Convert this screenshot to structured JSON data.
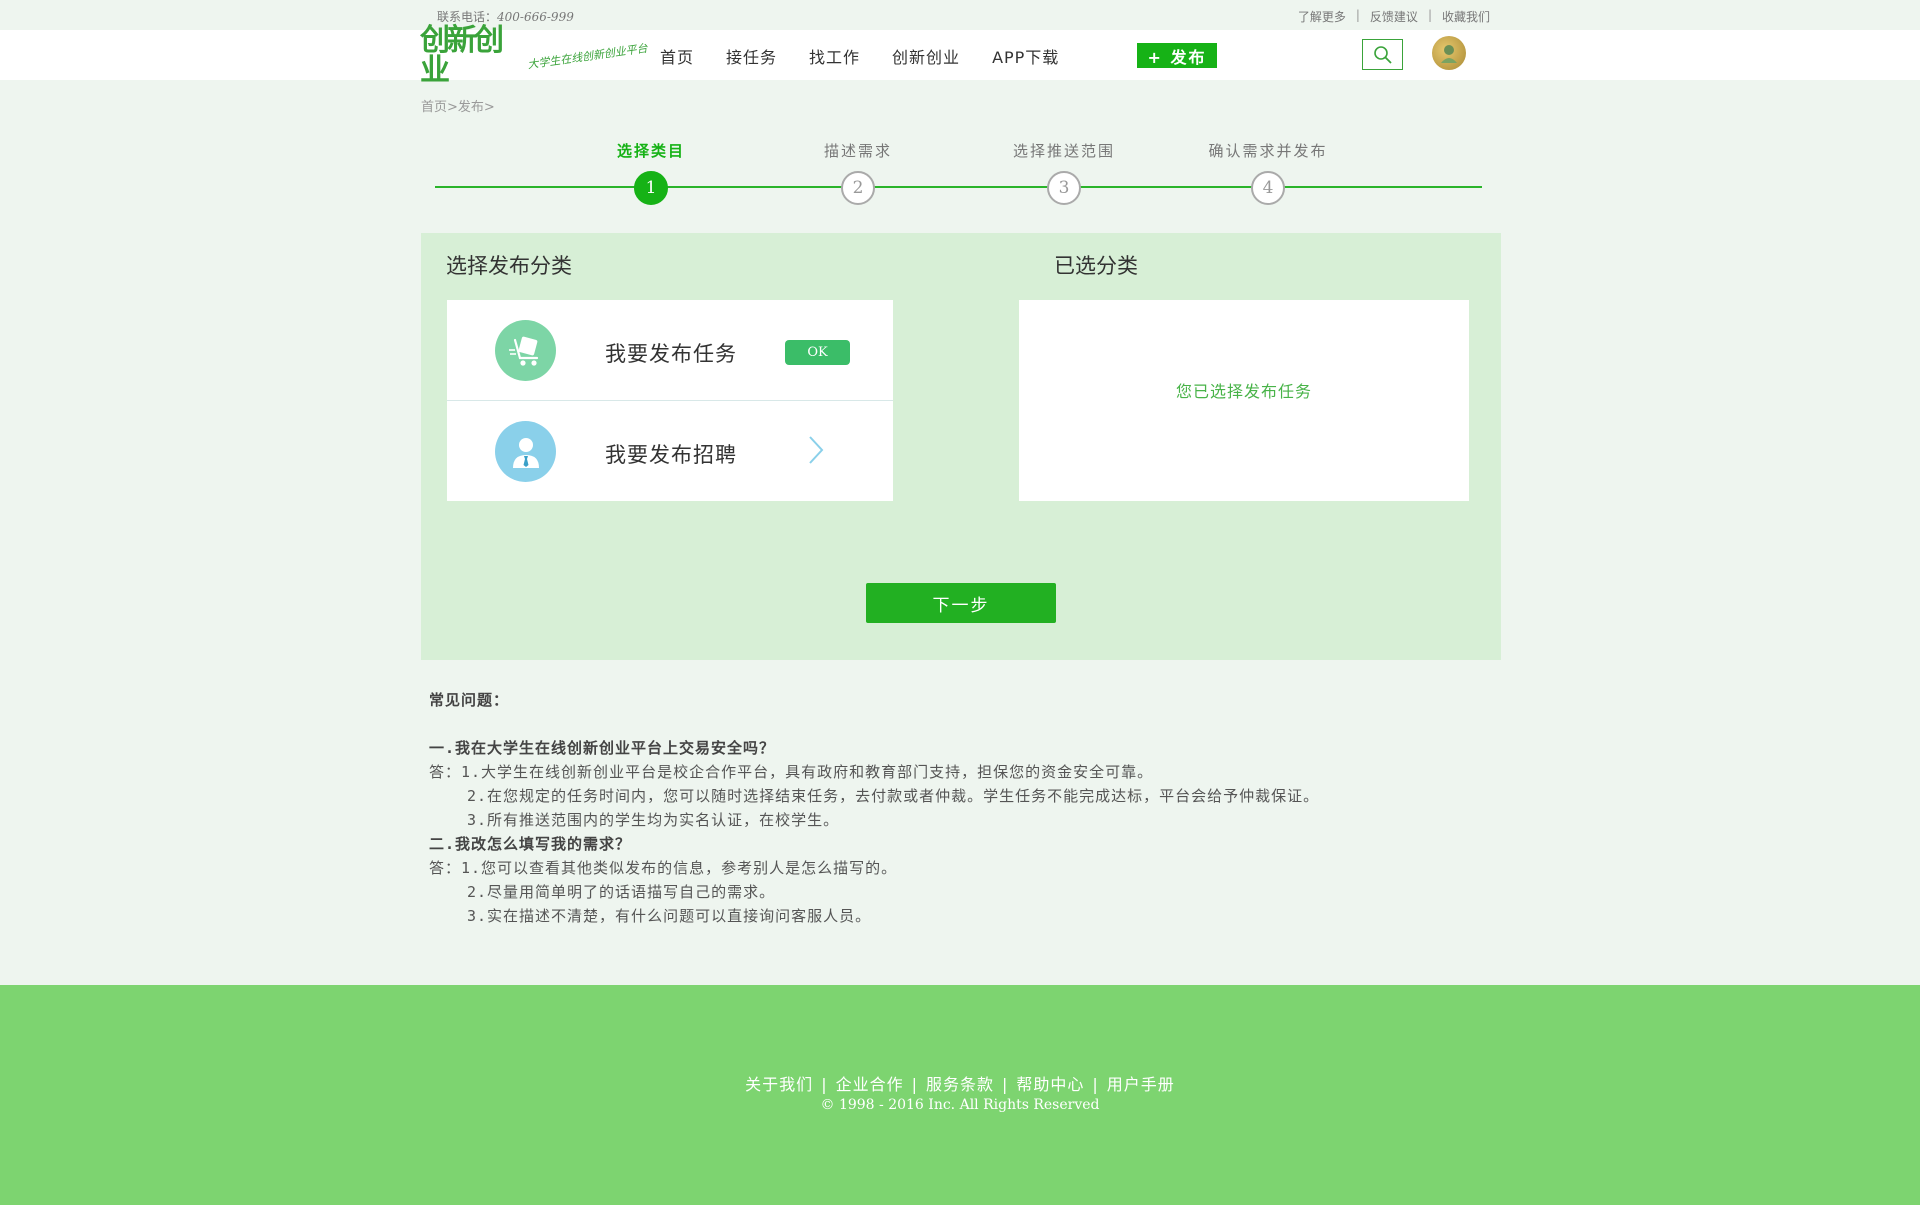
{
  "topbar": {
    "phone_label": "联系电话：",
    "phone_number": "400-666-999",
    "links": [
      "了解更多",
      "反馈建议",
      "收藏我们"
    ]
  },
  "header": {
    "logo_mark": "创新创业",
    "logo_slogan": "大学生在线创新创业平台",
    "nav": [
      "首页",
      "接任务",
      "找工作",
      "创新创业",
      "APP下载"
    ],
    "publish_button": "+ 发布"
  },
  "breadcrumb": "首页>发布>",
  "steps": [
    {
      "label": "选择类目",
      "num": "1",
      "active": true
    },
    {
      "label": "描述需求",
      "num": "2",
      "active": false
    },
    {
      "label": "选择推送范围",
      "num": "3",
      "active": false
    },
    {
      "label": "确认需求并发布",
      "num": "4",
      "active": false
    }
  ],
  "panel": {
    "left_heading": "选择发布分类",
    "right_heading": "已选分类",
    "categories": [
      {
        "label": "我要发布任务",
        "badge": "OK",
        "icon": "cart-icon"
      },
      {
        "label": "我要发布招聘",
        "icon": "person-icon"
      }
    ],
    "selected_text": "您已选择发布任务",
    "next_button": "下一步"
  },
  "faq": {
    "title": "常见问题：",
    "q1": "一.我在大学生在线创新创业平台上交易安全吗？",
    "a1_1": "答：1.大学生在线创新创业平台是校企合作平台，具有政府和教育部门支持，担保您的资金安全可靠。",
    "a1_2": "2.在您规定的任务时间内，您可以随时选择结束任务，去付款或者仲裁。学生任务不能完成达标，平台会给予仲裁保证。",
    "a1_3": "3.所有推送范围内的学生均为实名认证，在校学生。",
    "q2": "二.我改怎么填写我的需求？",
    "a2_1": "答：1.您可以查看其他类似发布的信息，参考别人是怎么描写的。",
    "a2_2": "2.尽量用简单明了的话语描写自己的需求。",
    "a2_3": "3.实在描述不清楚，有什么问题可以直接询问客服人员。"
  },
  "footer": {
    "links": [
      "关于我们",
      "企业合作",
      "服务条款",
      "帮助中心",
      "用户手册"
    ],
    "copyright": "© 1998 - 2016  Inc. All Rights Reserved"
  },
  "colors": {
    "accent": "#16b216",
    "panel_bg": "#d7efd6",
    "footer_bg": "#7dd470"
  }
}
